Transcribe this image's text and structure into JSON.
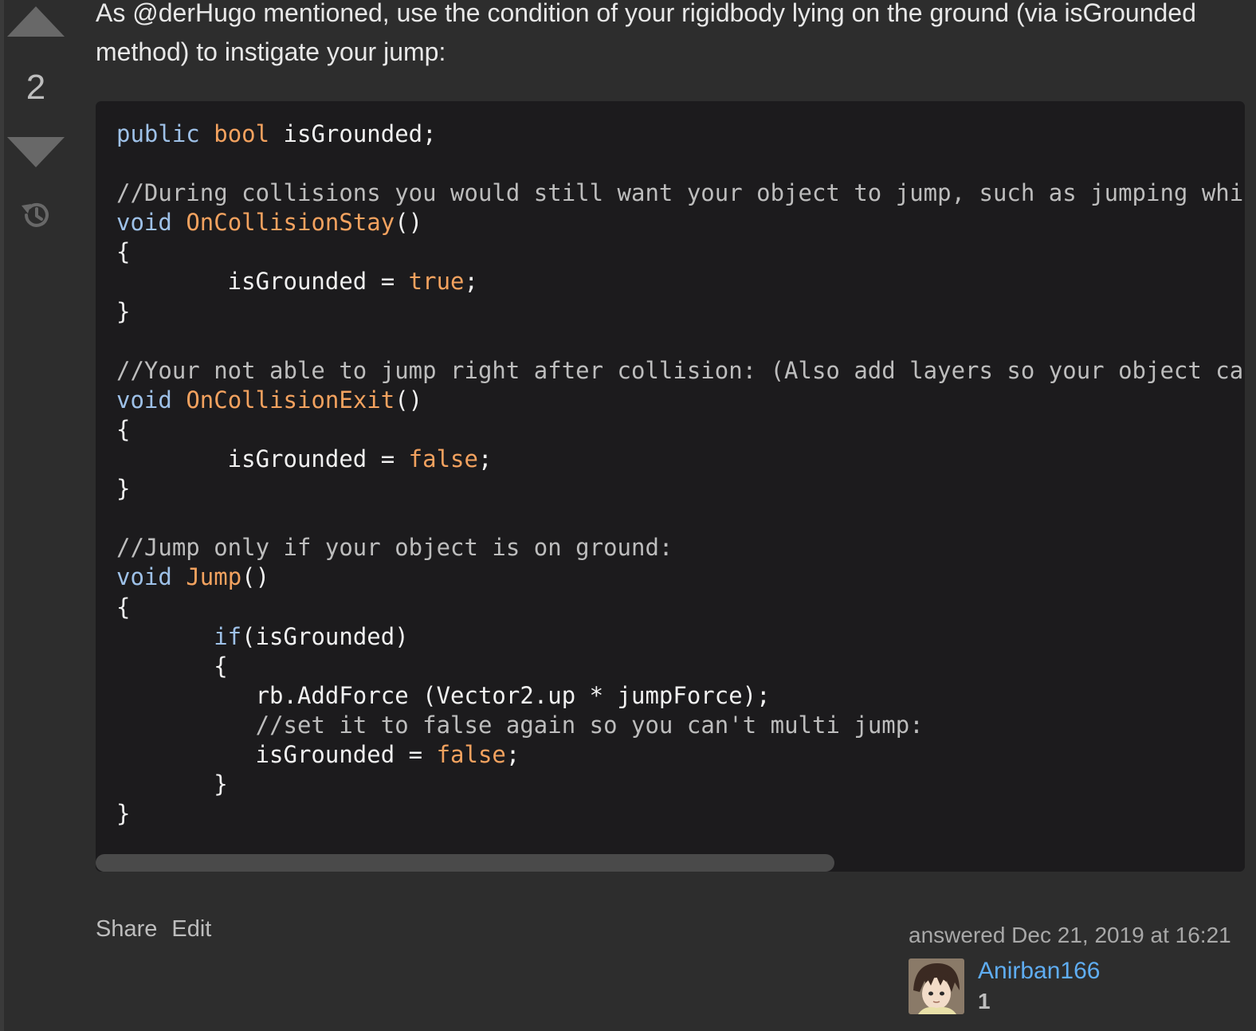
{
  "vote": {
    "count": "2"
  },
  "answer": {
    "intro": "As @derHugo mentioned, use the condition of your rigidbody lying on the ground (via isGrounded method) to instigate your jump:"
  },
  "code": {
    "l1_kw": "public",
    "l1_ty": "bool",
    "l1_rest": " isGrounded;",
    "c1": "//During collisions you would still want your object to jump, such as jumping while",
    "f1_kw": "void",
    "f1_name": "OnCollisionStay",
    "f1_parens": "()",
    "open_brace": "{",
    "close_brace": "}",
    "assign_indent": "        isGrounded = ",
    "lit_true": "true",
    "lit_false": "false",
    "semicolon": ";",
    "c2": "//Your not able to jump right after collision: (Also add layers so your object can'",
    "f2_kw": "void",
    "f2_name": "OnCollisionExit",
    "f2_parens": "()",
    "c3": "//Jump only if your object is on ground:",
    "f3_kw": "void",
    "f3_name": "Jump",
    "f3_parens": "()",
    "if_indent": "       ",
    "if_kw": "if",
    "if_rest": "(isGrounded)",
    "inner_open": "       {",
    "force_line": "          rb.AddForce (Vector2.up * jumpForce);",
    "inner_comment_indent": "          ",
    "c4": "//set it to false again so you can't multi jump:",
    "inner_assign": "          isGrounded = ",
    "inner_close": "       }"
  },
  "post_menu": {
    "share": "Share",
    "edit": "Edit"
  },
  "user": {
    "action_time": "answered Dec 21, 2019 at 16:21",
    "name": "Anirban166",
    "reputation": "1"
  },
  "colors": {
    "background": "#2d2d2d",
    "code_background": "#1c1b1d",
    "keyword": "#9ec1e8",
    "function": "#f3a25f",
    "link": "#5fadf2"
  }
}
